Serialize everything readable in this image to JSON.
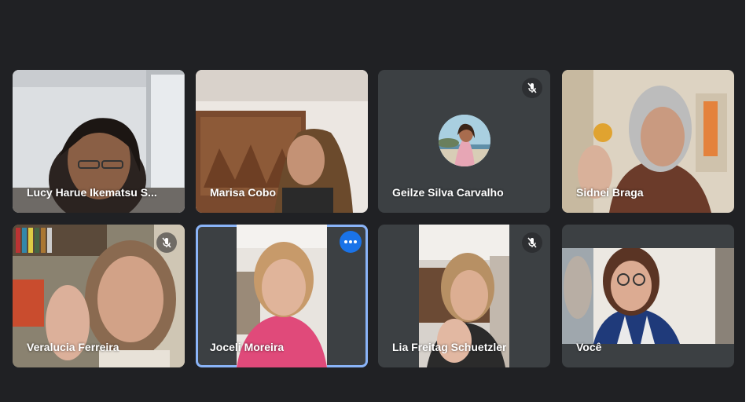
{
  "participants": [
    {
      "name": "Lucy Harue Ikematsu S...",
      "muted": false
    },
    {
      "name": "Marisa Cobo",
      "muted": false
    },
    {
      "name": "Geilze Silva Carvalho",
      "muted": true,
      "camera": "off"
    },
    {
      "name": "Sidnei Braga",
      "muted": false
    },
    {
      "name": "Veralucia Ferreira",
      "muted": true
    },
    {
      "name": "Joceli Moreira",
      "muted": false,
      "highlighted": true
    },
    {
      "name": "Lia Freitag Schuetzler",
      "muted": true
    },
    {
      "name": "Você",
      "muted": false
    }
  ],
  "colors": {
    "background": "#202124",
    "tile": "#3c4043",
    "highlight": "#8ab4f8",
    "accent": "#1a73e8"
  },
  "icons": {
    "mute": "mic-off-icon",
    "more": "more-options-icon"
  }
}
